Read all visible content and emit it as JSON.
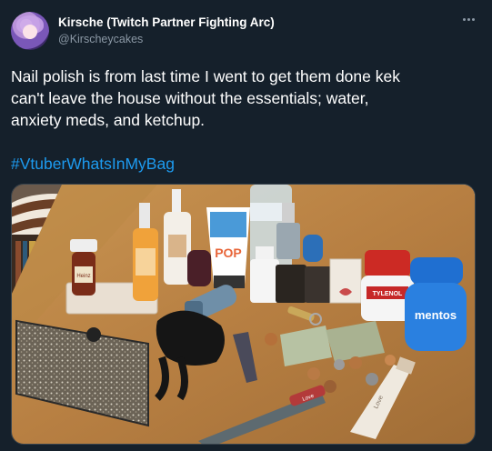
{
  "author": {
    "display_name": "Kirsche (Twitch Partner Fighting Arc)",
    "handle": "@Kirscheycakes"
  },
  "tweet": {
    "text_lines": [
      "Nail polish is from last time I went to get them done kek",
      "can't leave the house without the essentials; water,",
      "anxiety meds, and ketchup."
    ],
    "hashtag": "#VtuberWhatsInMyBag"
  },
  "photo": {
    "items": {
      "ketchup_label": "Heinz",
      "sunscreen_label": "POP",
      "meds_label": "TYLENOL",
      "gum_label": "mentos",
      "lipbalm_label": "Love",
      "nailfile_label": "Love"
    }
  },
  "colors": {
    "background": "#15202b",
    "text": "#ffffff",
    "secondary_text": "#8b98a5",
    "link": "#1d9bf0",
    "border": "#38444d"
  }
}
